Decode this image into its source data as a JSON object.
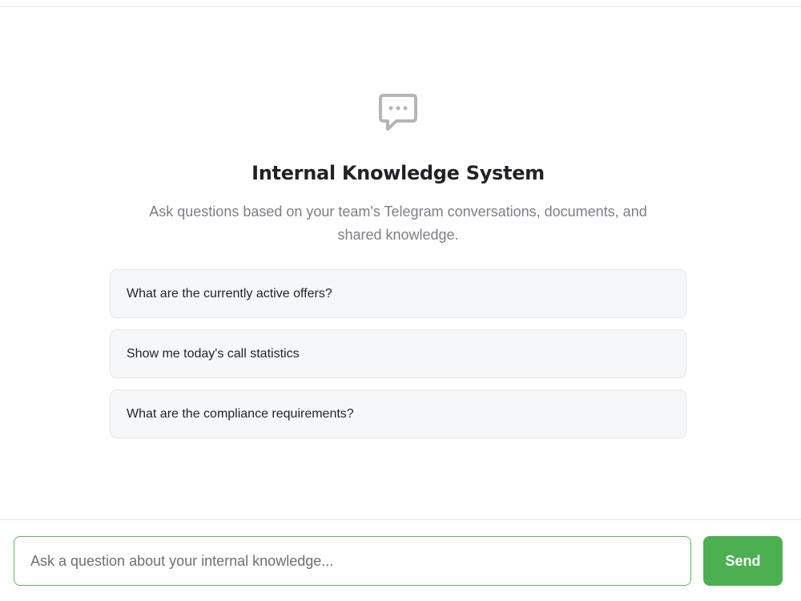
{
  "empty_state": {
    "icon": "chat-bubble-ellipsis-icon",
    "title": "Internal Knowledge System",
    "subtitle": "Ask questions based on your team's Telegram conversations, documents, and shared knowledge."
  },
  "suggestions": [
    {
      "label": "What are the currently active offers?"
    },
    {
      "label": "Show me today's call statistics"
    },
    {
      "label": "What are the compliance requirements?"
    }
  ],
  "composer": {
    "placeholder": "Ask a question about your internal knowledge...",
    "value": "",
    "send_label": "Send"
  },
  "colors": {
    "accent": "#4caf50",
    "input_border": "#5cb85c",
    "icon": "#b3b5b8"
  }
}
